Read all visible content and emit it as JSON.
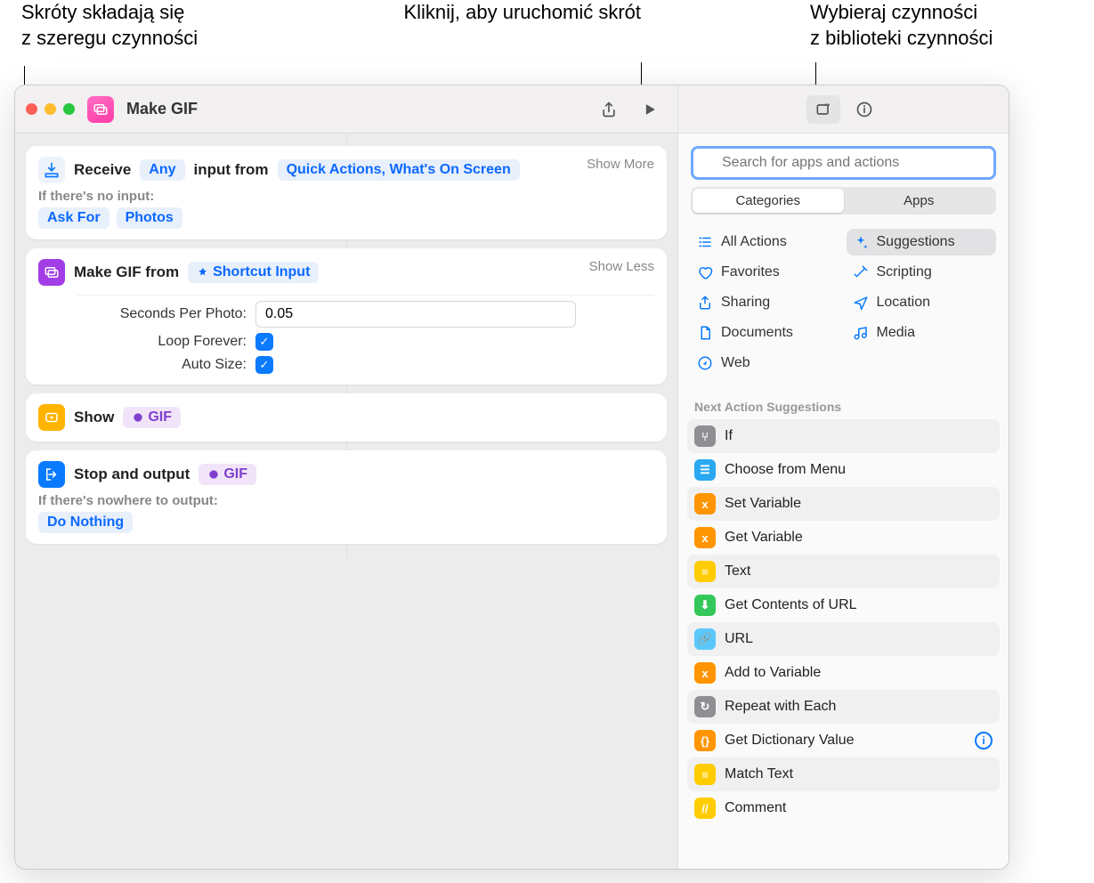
{
  "callouts": {
    "left": "Skróty składają się z szeregu czynności",
    "center": "Kliknij, aby uruchomić skrót",
    "right": "Wybieraj czynności z biblioteki czynności"
  },
  "window": {
    "title": "Make GIF"
  },
  "actions": {
    "receive": {
      "label": "Receive",
      "tokenAny": "Any",
      "midText": "input from",
      "tokenSource": "Quick Actions, What's On Screen",
      "showMore": "Show More",
      "noInputLabel": "If there's no input:",
      "askFor": "Ask For",
      "photos": "Photos"
    },
    "makegif": {
      "label": "Make GIF from",
      "tokenInput": "Shortcut Input",
      "showLess": "Show Less",
      "secondsLabel": "Seconds Per Photo:",
      "secondsValue": "0.05",
      "loopLabel": "Loop Forever:",
      "autoLabel": "Auto Size:"
    },
    "show": {
      "label": "Show",
      "token": "GIF"
    },
    "stop": {
      "label": "Stop and output",
      "token": "GIF",
      "nowhereLabel": "If there's nowhere to output:",
      "doNothing": "Do Nothing"
    }
  },
  "library": {
    "searchPlaceholder": "Search for apps and actions",
    "tabs": {
      "categories": "Categories",
      "apps": "Apps"
    },
    "categories": [
      {
        "label": "All Actions",
        "icon": "list",
        "color": "#0a7aff"
      },
      {
        "label": "Suggestions",
        "icon": "sparkle",
        "color": "#0a7aff",
        "active": true
      },
      {
        "label": "Favorites",
        "icon": "heart",
        "color": "#0a7aff"
      },
      {
        "label": "Scripting",
        "icon": "wand",
        "color": "#0a7aff"
      },
      {
        "label": "Sharing",
        "icon": "share",
        "color": "#0a7aff"
      },
      {
        "label": "Location",
        "icon": "nav",
        "color": "#0a7aff"
      },
      {
        "label": "Documents",
        "icon": "doc",
        "color": "#0a7aff"
      },
      {
        "label": "Media",
        "icon": "music",
        "color": "#0a7aff"
      },
      {
        "label": "Web",
        "icon": "compass",
        "color": "#0a7aff"
      }
    ],
    "suggestionsHeader": "Next Action Suggestions",
    "suggestions": [
      {
        "label": "If",
        "color": "#8e8e93",
        "glyph": "⑂"
      },
      {
        "label": "Choose from Menu",
        "color": "#2aa8f2",
        "glyph": "☰"
      },
      {
        "label": "Set Variable",
        "color": "#ff9500",
        "glyph": "x"
      },
      {
        "label": "Get Variable",
        "color": "#ff9500",
        "glyph": "x"
      },
      {
        "label": "Text",
        "color": "#ffcc00",
        "glyph": "≡"
      },
      {
        "label": "Get Contents of URL",
        "color": "#34c759",
        "glyph": "⬇"
      },
      {
        "label": "URL",
        "color": "#5ac8fa",
        "glyph": "🔗"
      },
      {
        "label": "Add to Variable",
        "color": "#ff9500",
        "glyph": "x"
      },
      {
        "label": "Repeat with Each",
        "color": "#8e8e93",
        "glyph": "↻"
      },
      {
        "label": "Get Dictionary Value",
        "color": "#ff9500",
        "glyph": "{}",
        "info": true
      },
      {
        "label": "Match Text",
        "color": "#ffcc00",
        "glyph": "≡"
      },
      {
        "label": "Comment",
        "color": "#ffcc00",
        "glyph": "//"
      }
    ]
  }
}
